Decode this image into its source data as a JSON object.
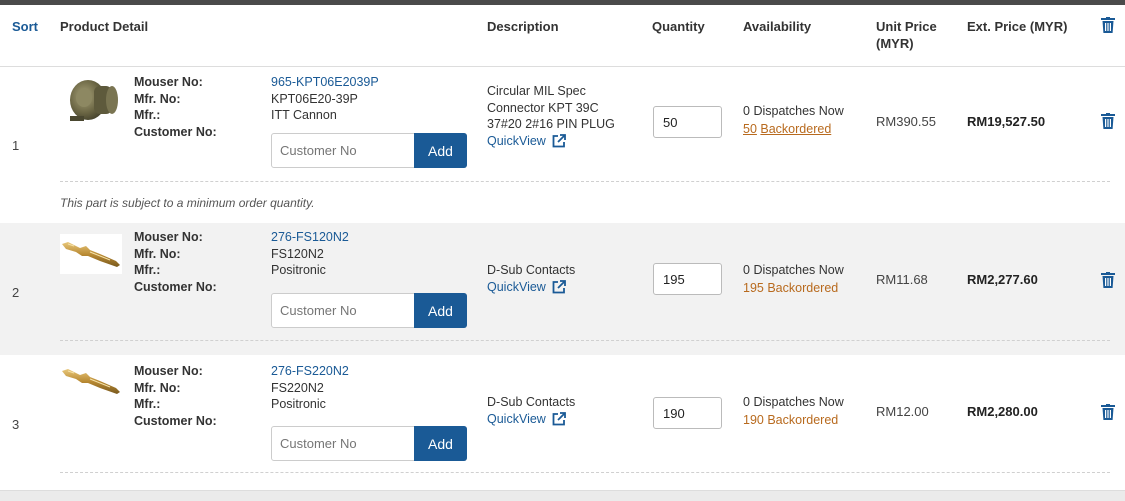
{
  "header": {
    "sort": "Sort",
    "product_detail": "Product Detail",
    "description": "Description",
    "quantity": "Quantity",
    "availability": "Availability",
    "unit_price_1": "Unit Price",
    "unit_price_2": "(MYR)",
    "ext_price": "Ext. Price (MYR)"
  },
  "labels": {
    "mouser_no": "Mouser No:",
    "mfr_no": "Mfr. No:",
    "mfr": "Mfr.:",
    "customer_no": "Customer No:",
    "customer_placeholder": "Customer No",
    "add": "Add",
    "quickview": "QuickView"
  },
  "rows": [
    {
      "num": "1",
      "mouser_no": "965-KPT06E2039P",
      "mfr_no": "KPT06E20-39P",
      "mfr": "ITT Cannon",
      "desc_lines": [
        "Circular MIL Spec",
        "Connector KPT 39C",
        "37#20 2#16 PIN PLUG"
      ],
      "qty": "50",
      "dispatch_count": "0",
      "dispatch_text": "Dispatches Now",
      "backorder_count": "50",
      "backorder_text": "Backordered",
      "unit_price": "RM390.55",
      "ext_price": "RM19,527.50",
      "note": "This part is subject to a minimum order quantity."
    },
    {
      "num": "2",
      "mouser_no": "276-FS120N2",
      "mfr_no": "FS120N2",
      "mfr": "Positronic",
      "desc_lines": [
        "D-Sub Contacts"
      ],
      "qty": "195",
      "dispatch_count": "0",
      "dispatch_text": "Dispatches Now",
      "backorder_count": "195",
      "backorder_text": "Backordered",
      "unit_price": "RM11.68",
      "ext_price": "RM2,277.60"
    },
    {
      "num": "3",
      "mouser_no": "276-FS220N2",
      "mfr_no": "FS220N2",
      "mfr": "Positronic",
      "desc_lines": [
        "D-Sub Contacts"
      ],
      "qty": "190",
      "dispatch_count": "0",
      "dispatch_text": "Dispatches Now",
      "backorder_count": "190",
      "backorder_text": "Backordered",
      "unit_price": "RM12.00",
      "ext_price": "RM2,280.00"
    }
  ],
  "colors": {
    "link": "#1a5a96",
    "backorder": "#b86a1e",
    "add_button": "#1a5a96",
    "row_shade": "#f2f2f2"
  },
  "icons": {
    "trash": "trash-icon",
    "external": "external-link-icon",
    "connector": "circular-connector-image",
    "contact": "dsub-contact-pin-image"
  }
}
